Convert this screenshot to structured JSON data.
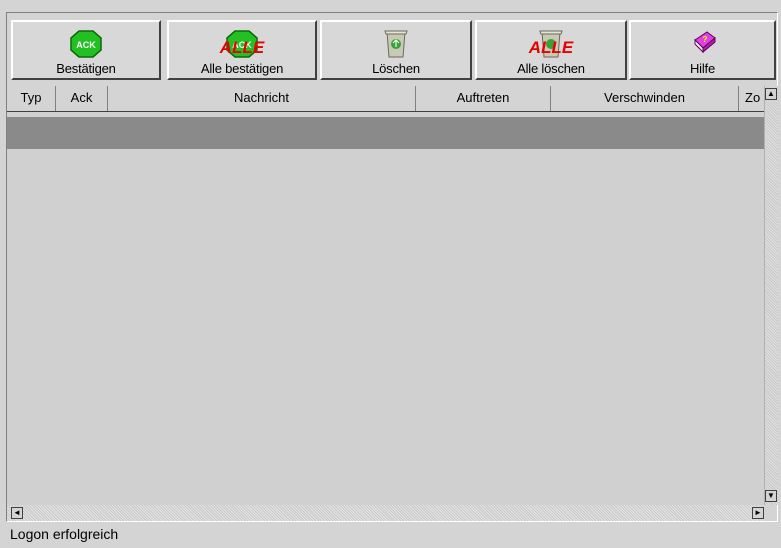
{
  "toolbar": {
    "buttons": [
      {
        "label": "Bestätigen",
        "icon": "ack-stop-icon"
      },
      {
        "label": "Alle bestätigen",
        "icon": "ack-all-icon",
        "overlay": "ALLE"
      },
      {
        "label": "Löschen",
        "icon": "trash-icon"
      },
      {
        "label": "Alle löschen",
        "icon": "trash-all-icon",
        "overlay": "ALLE"
      },
      {
        "label": "Hilfe",
        "icon": "help-book-icon"
      }
    ],
    "ack_text": "ACK"
  },
  "table": {
    "columns": [
      "Typ",
      "Ack",
      "Nachricht",
      "Auftreten",
      "Verschwinden",
      "Zo"
    ]
  },
  "status": {
    "text": "Logon erfolgreich"
  },
  "colors": {
    "accent_red": "#e60000",
    "ack_green": "#22c022",
    "selected_row": "#8a8a8a"
  }
}
